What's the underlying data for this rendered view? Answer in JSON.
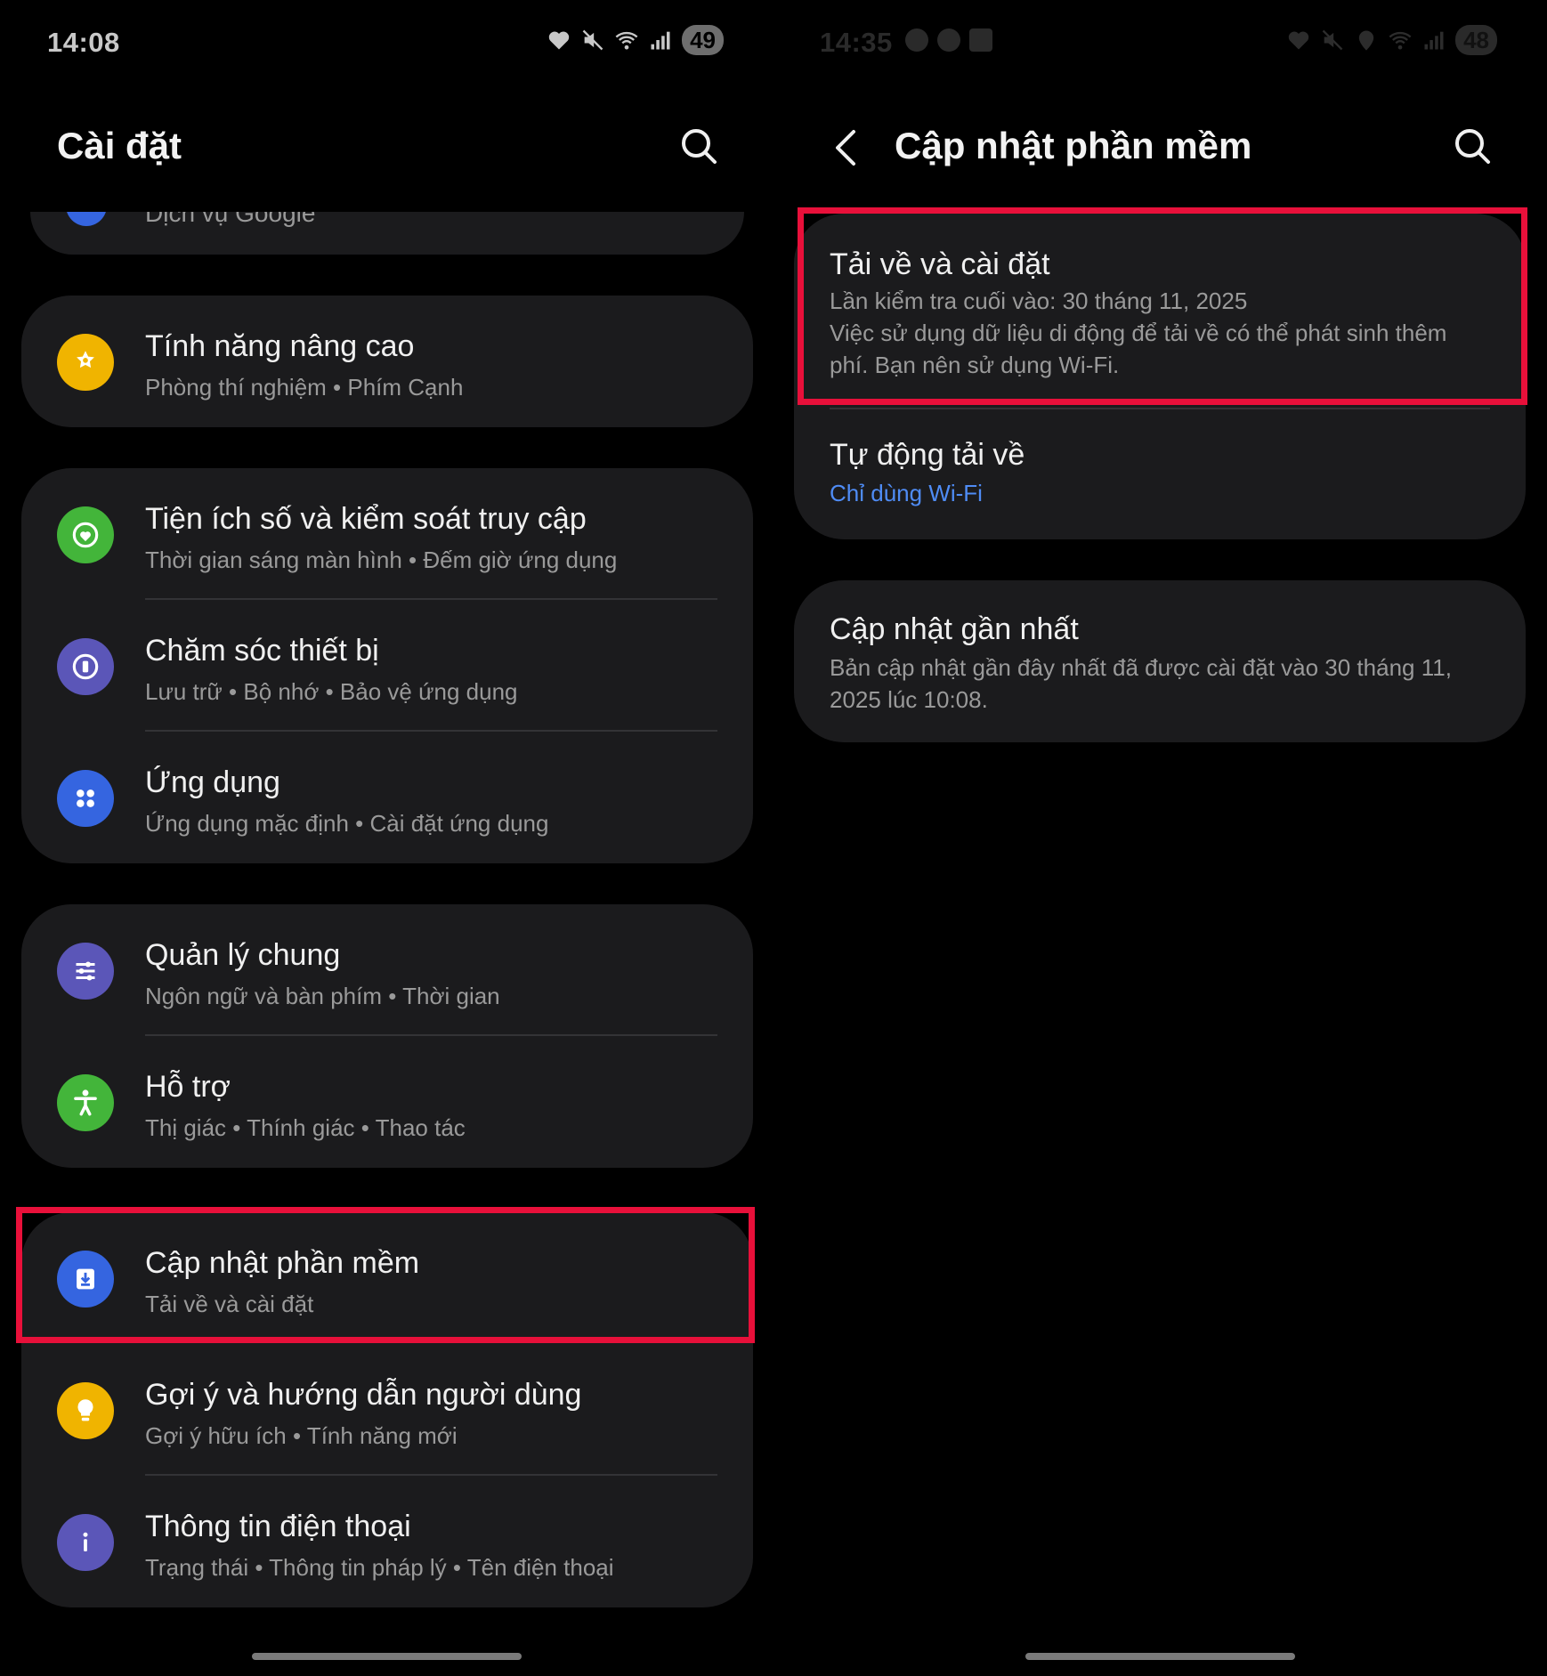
{
  "left": {
    "status": {
      "time": "14:08",
      "battery": "49"
    },
    "title": "Cài đặt",
    "peek_item": "Dịch vụ Google",
    "groups": [
      [
        {
          "title": "Tính năng nâng cao",
          "subtitle": "Phòng thí nghiệm  •  Phím Cạnh",
          "icon": "advanced-features-icon",
          "color": "#f0b400"
        }
      ],
      [
        {
          "title": "Tiện ích số và kiểm soát truy cập",
          "subtitle": "Thời gian sáng màn hình  •  Đếm giờ ứng dụng",
          "icon": "digital-wellbeing-icon",
          "color": "#43b53a"
        },
        {
          "title": "Chăm sóc thiết bị",
          "subtitle": "Lưu trữ  •  Bộ nhớ  •  Bảo vệ ứng dụng",
          "icon": "device-care-icon",
          "color": "#5b56b8"
        },
        {
          "title": "Ứng dụng",
          "subtitle": "Ứng dụng mặc định  •  Cài đặt ứng dụng",
          "icon": "apps-icon",
          "color": "#3565e0"
        }
      ],
      [
        {
          "title": "Quản lý chung",
          "subtitle": "Ngôn ngữ và bàn phím  •  Thời gian",
          "icon": "general-management-icon",
          "color": "#5b56b8"
        },
        {
          "title": "Hỗ trợ",
          "subtitle": "Thị giác  •  Thính giác  •  Thao tác",
          "icon": "accessibility-icon",
          "color": "#43b53a"
        }
      ],
      [
        {
          "title": "Cập nhật phần mềm",
          "subtitle": "Tải về và cài đặt",
          "icon": "software-update-icon",
          "color": "#3565e0"
        },
        {
          "title": "Gợi ý và hướng dẫn người dùng",
          "subtitle": "Gợi ý hữu ích  •  Tính năng mới",
          "icon": "tips-icon",
          "color": "#f0b400"
        },
        {
          "title": "Thông tin điện thoại",
          "subtitle": "Trạng thái  •  Thông tin pháp lý  •  Tên điện thoại",
          "icon": "about-phone-icon",
          "color": "#5b56b8"
        }
      ]
    ]
  },
  "right": {
    "status": {
      "time": "14:35",
      "battery": "48"
    },
    "title": "Cập nhật phần mềm",
    "download": {
      "title": "Tải về và cài đặt",
      "line1": "Lần kiểm tra cuối vào: 30 tháng 11, 2025",
      "line2": "Việc sử dụng dữ liệu di động để tải về có thể phát sinh thêm",
      "line3": "phí. Bạn nên sử dụng Wi-Fi."
    },
    "auto": {
      "title": "Tự động tải về",
      "value": "Chỉ dùng Wi-Fi"
    },
    "last": {
      "title": "Cập nhật gần nhất",
      "line1": "Bản cập nhật gần đây nhất đã được cài đặt vào 30 tháng 11,",
      "line2": "2025 lúc 10:08."
    }
  }
}
